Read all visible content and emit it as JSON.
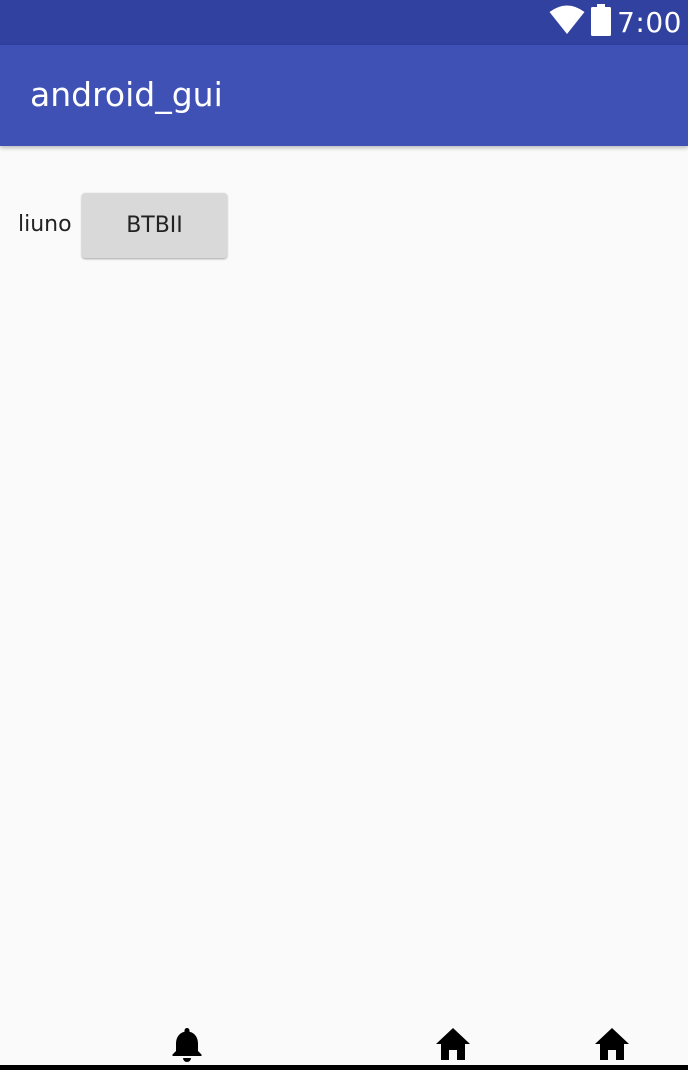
{
  "status_bar": {
    "time": "7:00",
    "icons": [
      "wifi-icon",
      "battery-icon"
    ],
    "color": "#3041a0"
  },
  "app_bar": {
    "title": "android_gui",
    "color": "#3f51b5"
  },
  "main": {
    "label": "liuno",
    "button_label": "BTBII"
  },
  "bottom_icons": [
    "bell-icon",
    "home-icon",
    "home-icon"
  ]
}
